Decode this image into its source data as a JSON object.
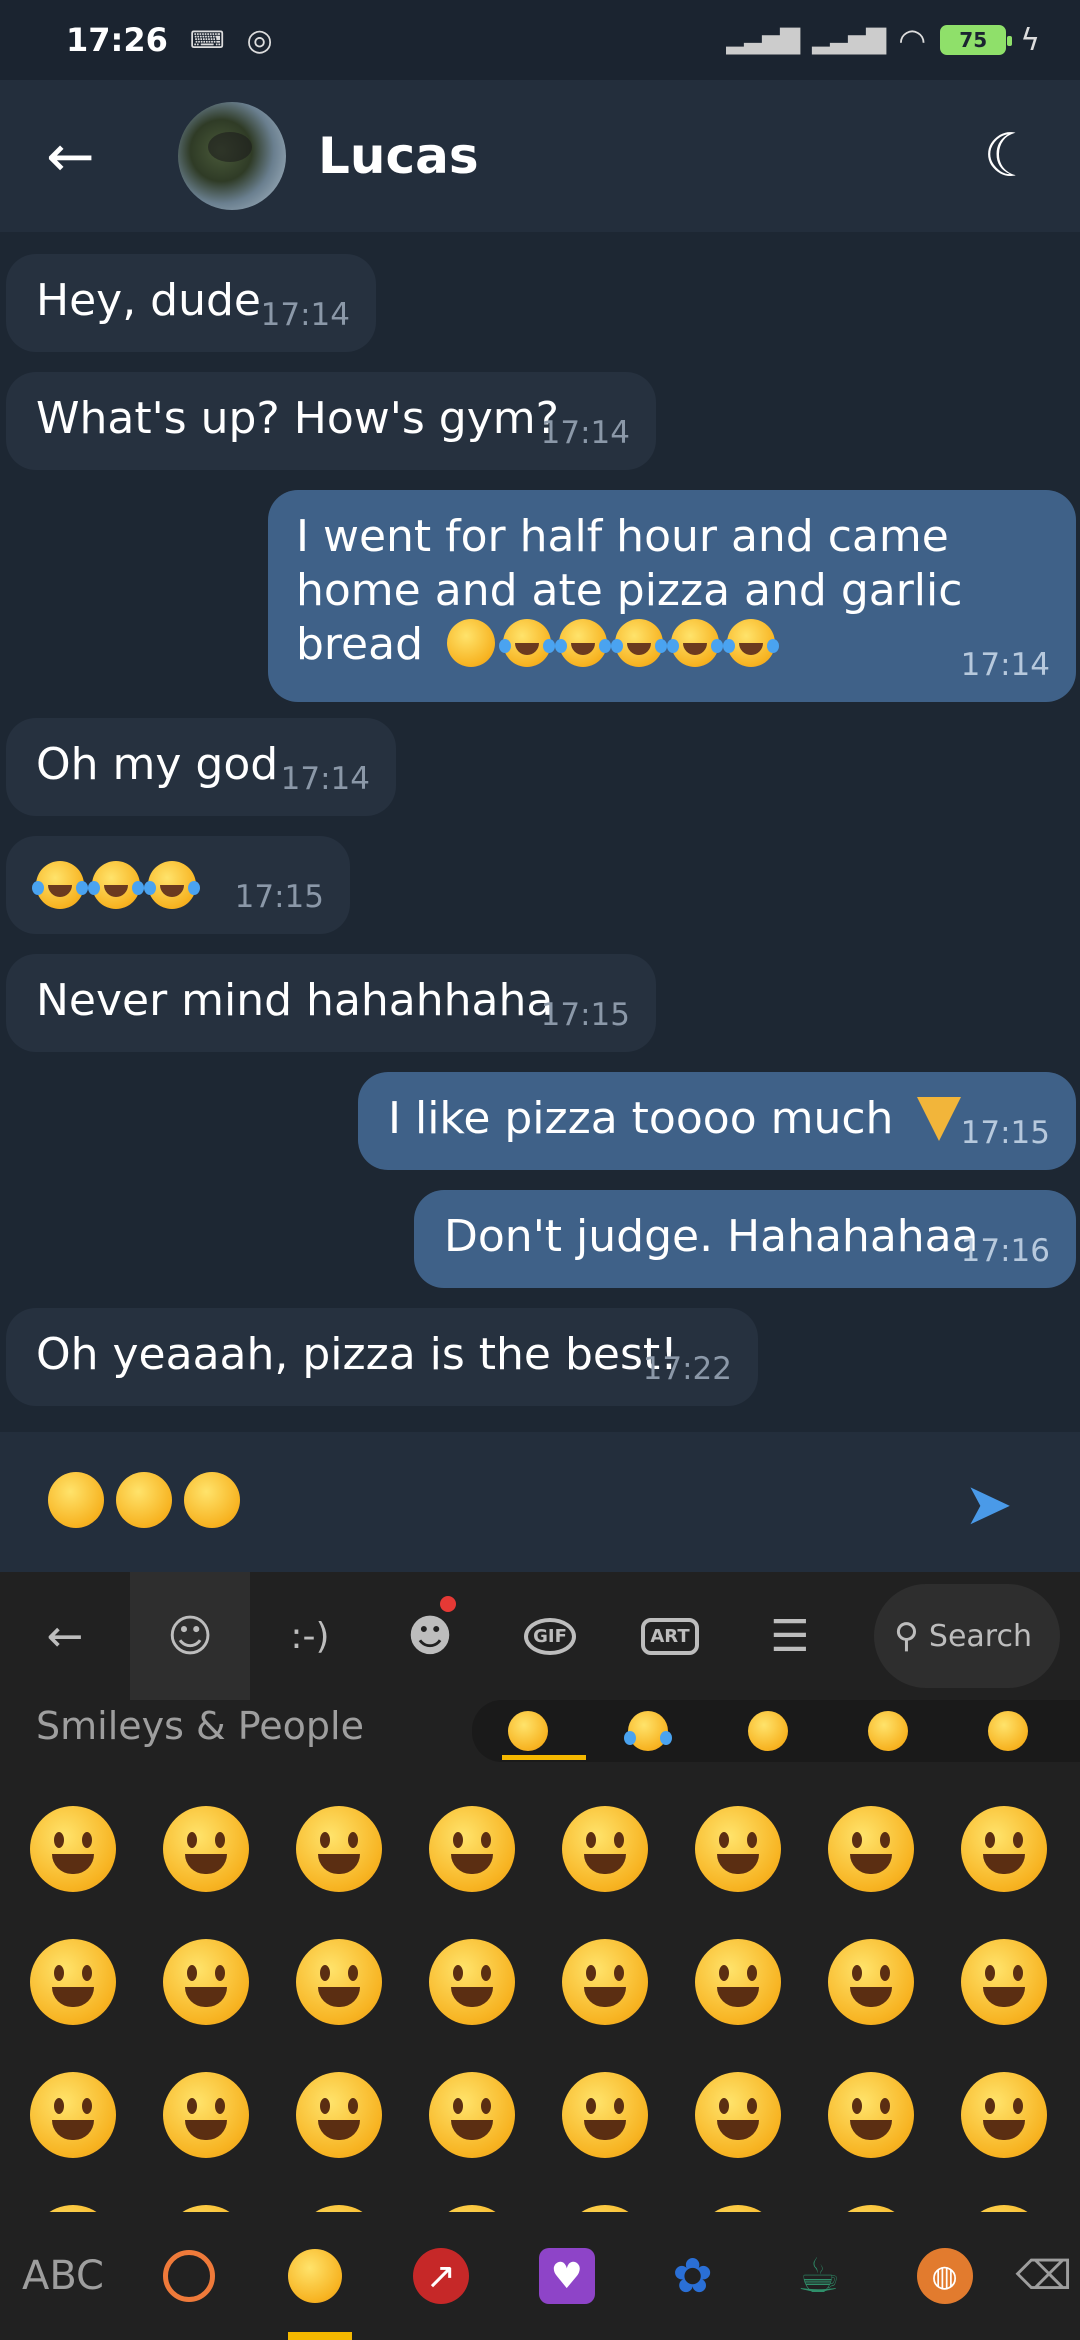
{
  "status_bar": {
    "time": "17:26",
    "battery": "75"
  },
  "header": {
    "contact_name": "Lucas"
  },
  "messages": [
    {
      "dir": "in",
      "text": "Hey, dude",
      "time": "17:14"
    },
    {
      "dir": "in",
      "text": "What's up? How's gym?",
      "time": "17:14"
    },
    {
      "dir": "out",
      "text_line1": "I went for half hour and came",
      "text_line2": "home and ate pizza and garlic",
      "text_line3": "bread",
      "time": "17:14"
    },
    {
      "dir": "in",
      "text": "Oh my god",
      "time": "17:14"
    },
    {
      "dir": "in",
      "text": "",
      "time": "17:15"
    },
    {
      "dir": "in",
      "text": "Never mind hahahhaha",
      "time": "17:15"
    },
    {
      "dir": "out",
      "text": "I like pizza toooo much",
      "time": "17:15"
    },
    {
      "dir": "out",
      "text": "Don't judge. Hahahahaa",
      "time": "17:16"
    },
    {
      "dir": "in",
      "text": "Oh yeaaah, pizza is the best!",
      "time": "17:22"
    }
  ],
  "keyboard": {
    "search_label": "Search",
    "gif_label": "GIF",
    "art_label": "ART",
    "emoticon_label": ":-)",
    "category_label": "Smileys & People",
    "abc_label": "ABC"
  },
  "colors": {
    "incoming_bubble": "#26313f",
    "outgoing_bubble": "#3f6188",
    "accent": "#f5b800",
    "send": "#4a9ae8"
  }
}
